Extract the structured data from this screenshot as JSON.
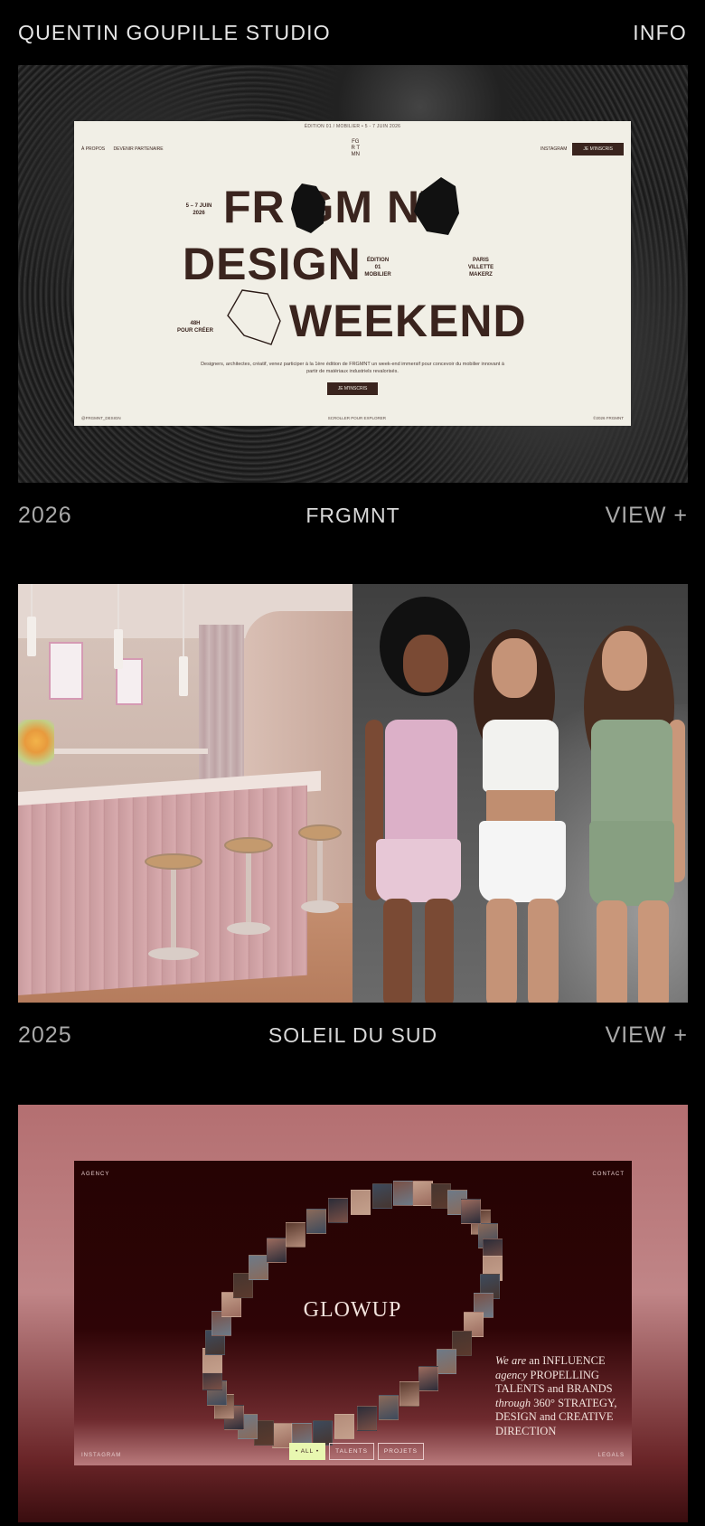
{
  "header": {
    "brand": "QUENTIN GOUPILLE STUDIO",
    "info": "INFO"
  },
  "projects": [
    {
      "year": "2026",
      "title": "FRGMNT",
      "view": "VIEW +"
    },
    {
      "year": "2025",
      "title": "SOLEIL DU SUD",
      "view": "VIEW +"
    },
    {
      "year": "",
      "title": "",
      "view": ""
    }
  ],
  "frgmnt": {
    "topline": "ÉDITION 01 / MOBILIER • 5 - 7 JUIN 2026",
    "nav_about": "À PROPOS",
    "nav_partner": "DEVENIR PARTENAIRE",
    "logo_l1": "FG",
    "logo_l2": "R  T",
    "logo_l3": "MN",
    "nav_instagram": "INSTAGRAM",
    "nav_cta": "JE M'INSCRIS",
    "line1": "FR  GM  NT",
    "line2": "DESIGN",
    "line3": "WEEKEND",
    "dates_l1": "5 – 7 JUIN",
    "dates_l2": "2026",
    "edition_l1": "ÉDITION",
    "edition_l2": "01",
    "edition_l3": "MOBILIER",
    "place_l1": "PARIS",
    "place_l2": "VILLETTE",
    "place_l3": "MAKERZ",
    "hours_l1": "48H",
    "hours_l2": "POUR CRÉER",
    "desc": "Designers, architectes, créatif, venez participer à la 1ère édition de FRGMNT un week-end immersif pour concevoir du mobilier innovant à partir de matériaux industriels revalorisés.",
    "cta": "JE M'INSCRIS",
    "foot_left": "@FRGMNT_DESIGN",
    "foot_center": "SCROLLER POUR EXPLORER",
    "foot_right": "©2026 FRGMNT"
  },
  "glowup": {
    "agency": "AGENCY",
    "contact": "CONTACT",
    "instagram": "INSTAGRAM",
    "legals": "LEGALS",
    "logo": "GLOWUP",
    "tag_1a": "We are",
    "tag_1b": " an INFLUENCE",
    "tag_2a": "agency",
    "tag_2b": " PROPELLING",
    "tag_3": "TALENTS and BRANDS",
    "tag_4a": "through",
    "tag_4b": " 360° STRATEGY,",
    "tag_5": "DESIGN and CREATIVE",
    "tag_6": "DIRECTION",
    "filters": [
      "• ALL •",
      "TALENTS",
      "PROJETS"
    ]
  }
}
